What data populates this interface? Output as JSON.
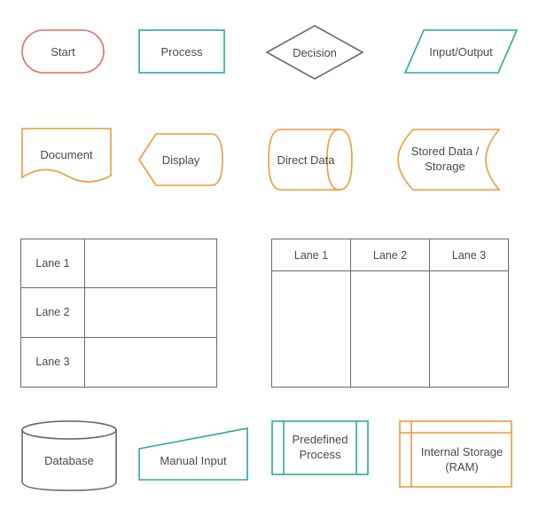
{
  "shapes": {
    "start": "Start",
    "process": "Process",
    "decision": "Decision",
    "input_output": "Input/Output",
    "document": "Document",
    "display": "Display",
    "direct_data": "Direct Data",
    "stored_data": "Stored Data / Storage",
    "database": "Database",
    "manual_input": "Manual Input",
    "predefined_process": "Predefined Process",
    "internal_storage": "Internal Storage (RAM)"
  },
  "swimlane_horizontal": {
    "lanes": [
      "Lane 1",
      "Lane 2",
      "Lane 3"
    ]
  },
  "swimlane_vertical": {
    "lanes": [
      "Lane 1",
      "Lane 2",
      "Lane 3"
    ]
  },
  "colors": {
    "red": "#e66a6a",
    "teal": "#2aa9a0",
    "orange": "#ee9a3a",
    "gray": "#6a6a6a"
  }
}
